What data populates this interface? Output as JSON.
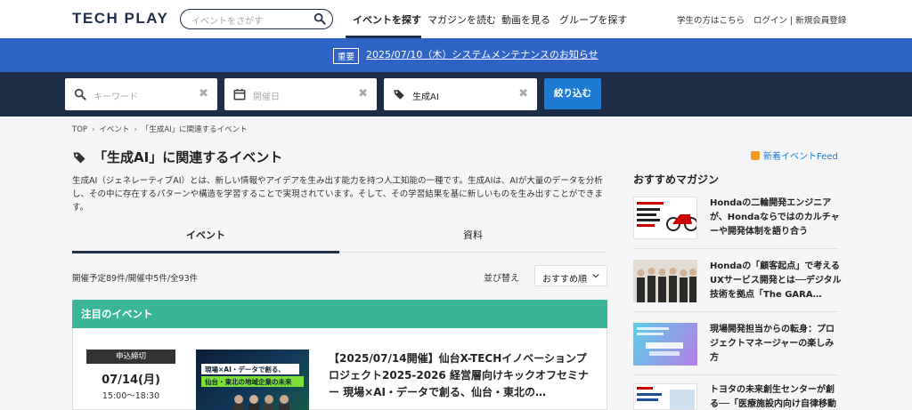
{
  "header": {
    "logo": "TECH PLAY",
    "search_placeholder": "イベントをさがす",
    "nav": [
      "イベントを探す",
      "マガジンを読む",
      "動画を見る",
      "グループを探す"
    ],
    "student_link": "学生の方はこちら",
    "auth_link": "ログイン | 新規会員登録"
  },
  "notice": {
    "badge": "重要",
    "text": "2025/07/10（木）システムメンテナンスのお知らせ"
  },
  "filter": {
    "keyword_placeholder": "キーワード",
    "date_placeholder": "開催日",
    "tag_value": "生成AI",
    "submit": "絞り込む"
  },
  "breadcrumb": [
    "TOP",
    "イベント",
    "「生成AI」に関連するイベント"
  ],
  "page": {
    "title": "「生成AI」に関連するイベント",
    "feed_link": "新着イベントFeed",
    "description": "生成AI（ジェネレーティブAI）とは、新しい情報やアイデアを生み出す能力を持つ人工知能の一種です。生成AIは、AIが大量のデータを分析し、その中に存在するパターンや構造を学習することで実現されています。そして、その学習結果を基に新しいものを生み出すことができます。"
  },
  "tabs": [
    "イベント",
    "資料"
  ],
  "list": {
    "counts": "開催予定89件/開催中5件/全93件",
    "sort_label": "並び替え",
    "sort_value": "おすすめ順"
  },
  "featured": {
    "heading": "注目のイベント",
    "event": {
      "badge": "申込締切",
      "date": "07/14(月)",
      "time": "15:00〜18:30",
      "thumb_text1": "現場×AI・データで創る、",
      "thumb_text2": "仙台・東北の地域企業の未来",
      "title": "【2025/07/14開催】仙台X-TECHイノベーションプロジェクト2025-2026 経営層向けキックオフセミナー 現場×AI・データで創る、仙台・東北の…"
    }
  },
  "sidebar": {
    "heading": "おすすめマガジン",
    "items": [
      {
        "title": "Hondaの二輪開発エンジニアが、Hondaならではのカルチャーや開発体制を語り合う"
      },
      {
        "title": "Hondaの「顧客起点」で考えるUXサービス開発とは──デジタル技術を拠点「The GARA…"
      },
      {
        "title": "現場開発担当からの転身：プロジェクトマネージャーの楽しみ方"
      },
      {
        "title": "トヨタの未来創生センターが創る──「医療施設内向け自律移動"
      }
    ]
  },
  "colors": {
    "navy": "#1d2c47",
    "notice_blue": "#2e64c6",
    "button_blue": "#1d7bd3",
    "featured_green": "#3ab598"
  }
}
